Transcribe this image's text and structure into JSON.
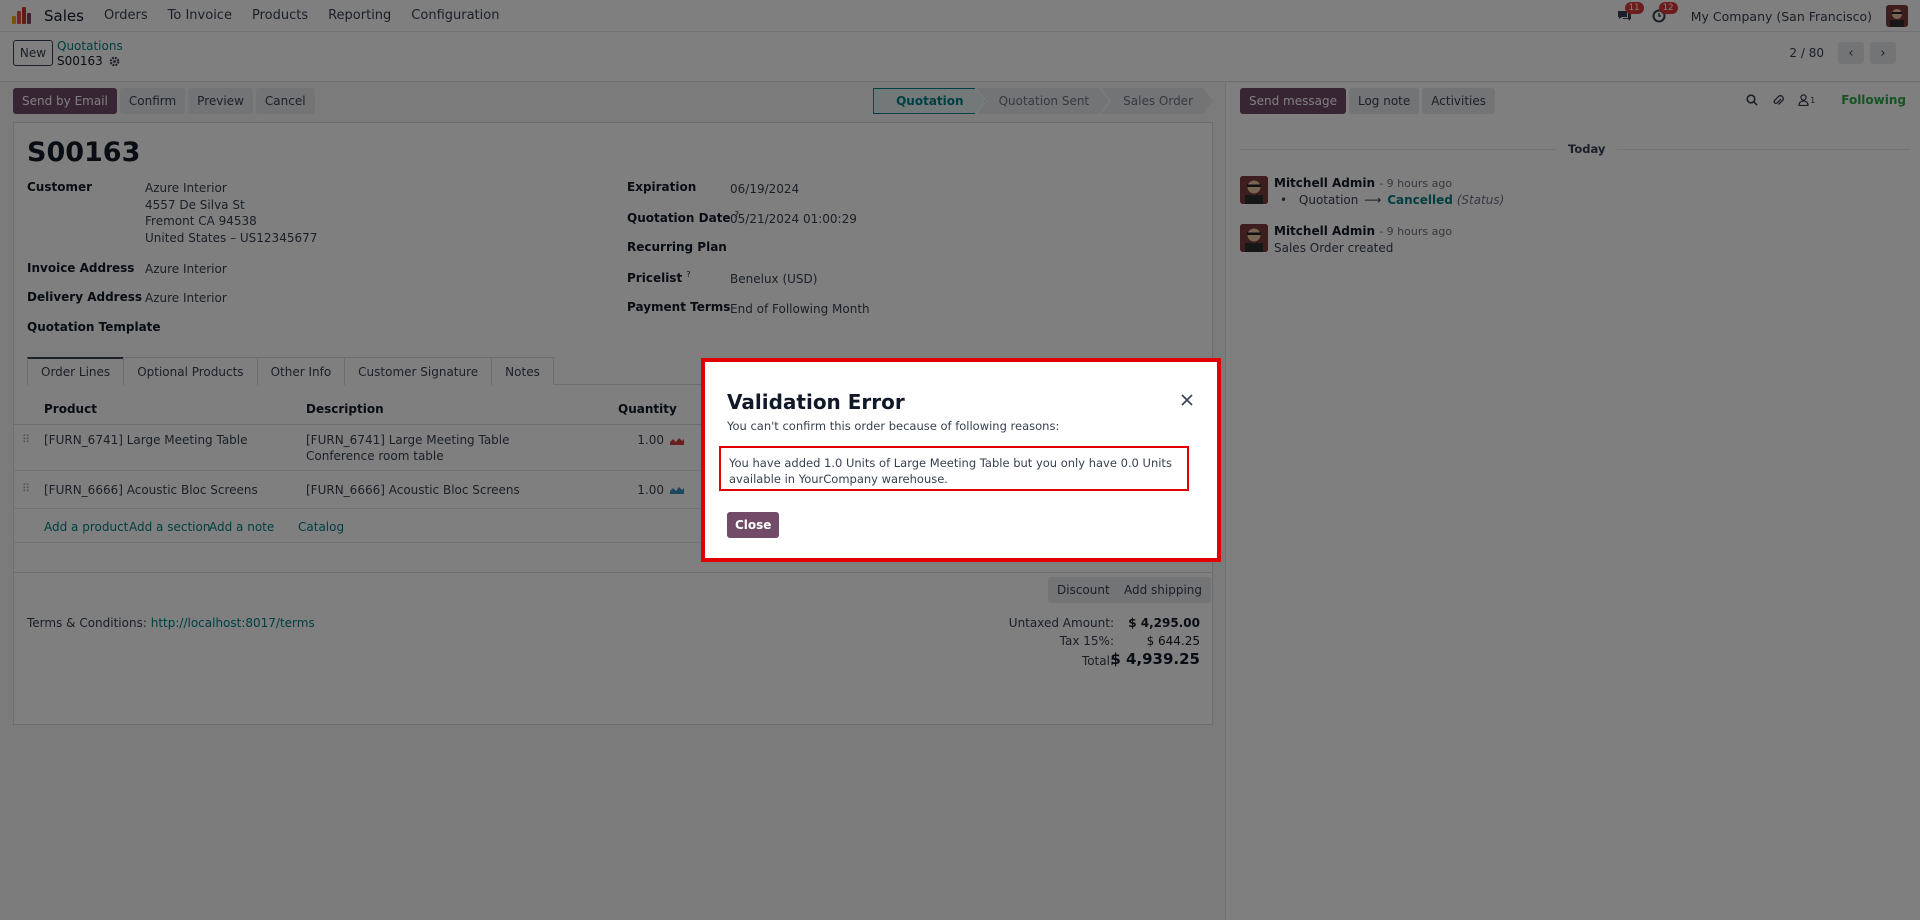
{
  "navbar": {
    "app_name": "Sales",
    "menu": [
      "Orders",
      "To Invoice",
      "Products",
      "Reporting",
      "Configuration"
    ],
    "messages_badge": "11",
    "activities_badge": "12",
    "company": "My Company (San Francisco)"
  },
  "control": {
    "new_label": "New",
    "breadcrumb": "Quotations",
    "record": "S00163",
    "pager": "2 / 80"
  },
  "actions": {
    "send_email": "Send by Email",
    "confirm": "Confirm",
    "preview": "Preview",
    "cancel": "Cancel"
  },
  "stages": [
    "Quotation",
    "Quotation Sent",
    "Sales Order"
  ],
  "form": {
    "title": "S00163",
    "customer_label": "Customer",
    "customer_name": "Azure Interior",
    "customer_street": "4557 De Silva St",
    "customer_city": "Fremont CA 94538",
    "customer_country": "United States – US12345677",
    "invoice_label": "Invoice Address",
    "invoice_value": "Azure Interior",
    "delivery_label": "Delivery Address",
    "delivery_value": "Azure Interior",
    "template_label": "Quotation Template",
    "expiration_label": "Expiration",
    "expiration_value": "06/19/2024",
    "qdate_label": "Quotation Date",
    "qdate_value": "05/21/2024 01:00:29",
    "recurring_label": "Recurring Plan",
    "pricelist_label": "Pricelist",
    "pricelist_value": "Benelux (USD)",
    "payment_label": "Payment Terms",
    "payment_value": "End of Following Month",
    "help_mark": "?"
  },
  "tabs": [
    "Order Lines",
    "Optional Products",
    "Other Info",
    "Customer Signature",
    "Notes"
  ],
  "order_lines": {
    "headers": {
      "product": "Product",
      "description": "Description",
      "quantity": "Quantity"
    },
    "rows": [
      {
        "product": "[FURN_6741] Large Meeting Table",
        "description": "[FURN_6741] Large Meeting Table",
        "description2": "Conference room table",
        "quantity": "1.00",
        "forecast_color": "#d23f3a"
      },
      {
        "product": "[FURN_6666] Acoustic Bloc Screens",
        "description": "[FURN_6666] Acoustic Bloc Screens",
        "description2": "",
        "quantity": "1.00",
        "forecast_color": "#3c8dbc"
      }
    ],
    "links": {
      "add_product": "Add a product",
      "add_section": "Add a section",
      "add_note": "Add a note",
      "catalog": "Catalog"
    }
  },
  "totals": {
    "discount": "Discount",
    "add_shipping": "Add shipping",
    "terms_label": "Terms & Conditions:",
    "terms_link": "http://localhost:8017/terms",
    "untaxed_label": "Untaxed Amount:",
    "untaxed_value": "$ 4,295.00",
    "tax_label": "Tax 15%:",
    "tax_value": "$ 644.25",
    "total_label": "Total:",
    "total_value": "$ 4,939.25"
  },
  "chatter": {
    "send_message": "Send message",
    "log_note": "Log note",
    "activities": "Activities",
    "followers_count": "1",
    "following": "Following",
    "today": "Today",
    "messages": [
      {
        "author": "Mitchell Admin",
        "time": "- 9 hours ago",
        "field": "Quotation",
        "arrow": "⟶",
        "new_value": "Cancelled",
        "field_note": "(Status)"
      },
      {
        "author": "Mitchell Admin",
        "time": "- 9 hours ago",
        "body": "Sales Order created"
      }
    ]
  },
  "dialog": {
    "title": "Validation Error",
    "subtitle": "You can't confirm this order because of following reasons:",
    "reason": "You have added 1.0 Units of Large Meeting Table but you only have 0.0 Units available in YourCompany warehouse.",
    "close": "Close"
  },
  "colors": {
    "primary": "#714b67",
    "link": "#017e84",
    "highlight": "#e00000"
  }
}
